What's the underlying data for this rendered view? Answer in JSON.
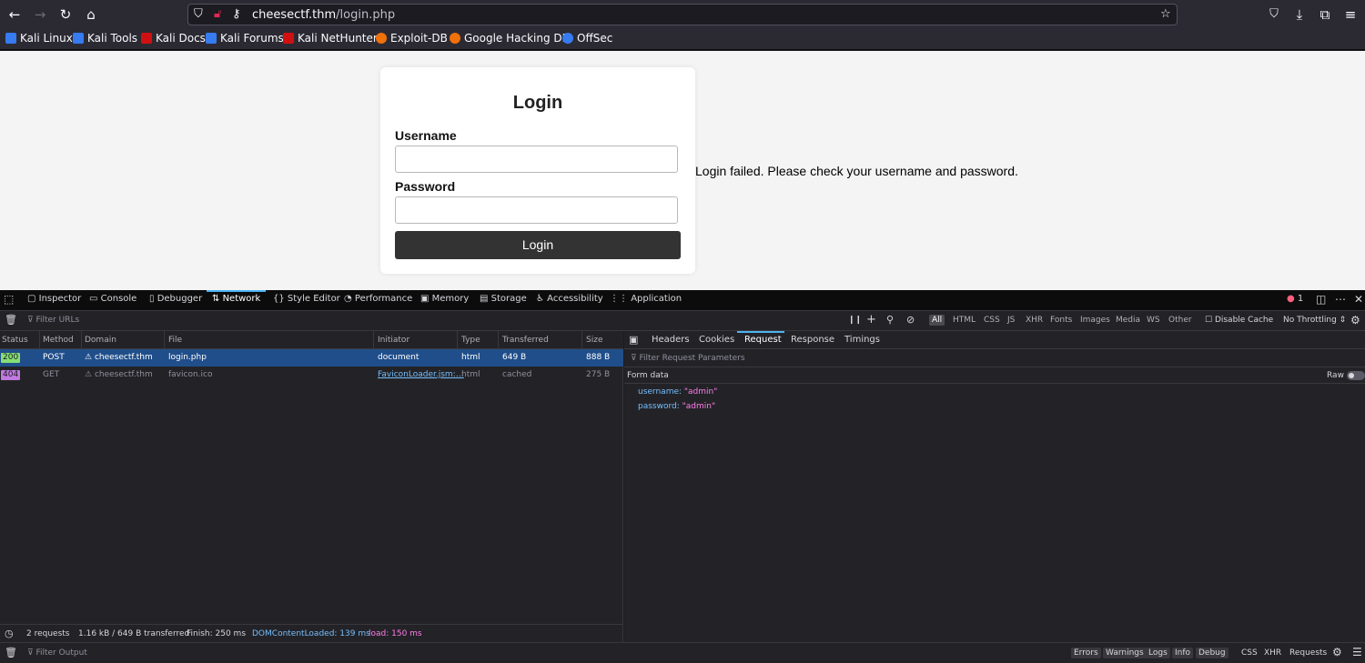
{
  "browser": {
    "url_host": "cheesectf.thm",
    "url_path": "/login.php",
    "bookmarks": [
      {
        "label": "Kali Linux",
        "color": "#367bf0"
      },
      {
        "label": "Kali Tools",
        "color": "#367bf0"
      },
      {
        "label": "Kali Docs",
        "color": "#d01010"
      },
      {
        "label": "Kali Forums",
        "color": "#367bf0"
      },
      {
        "label": "Kali NetHunter",
        "color": "#d01010"
      },
      {
        "label": "Exploit-DB",
        "color": "#f0700a"
      },
      {
        "label": "Google Hacking DB",
        "color": "#f0700a"
      },
      {
        "label": "OffSec",
        "color": "#367bf0"
      }
    ]
  },
  "page": {
    "title": "Login",
    "username_label": "Username",
    "password_label": "Password",
    "login_button": "Login",
    "error_message": "Login failed. Please check your username and password."
  },
  "devtools": {
    "tabs": [
      "Inspector",
      "Console",
      "Debugger",
      "Network",
      "Style Editor",
      "Performance",
      "Memory",
      "Storage",
      "Accessibility",
      "Application"
    ],
    "active_tab": "Network",
    "error_count": "1",
    "filter_placeholder": "Filter URLs",
    "type_filters": [
      "All",
      "HTML",
      "CSS",
      "JS",
      "XHR",
      "Fonts",
      "Images",
      "Media",
      "WS",
      "Other"
    ],
    "disable_cache": "Disable Cache",
    "throttling": "No Throttling",
    "columns": [
      "Status",
      "Method",
      "Domain",
      "File",
      "Initiator",
      "Type",
      "Transferred",
      "Size"
    ],
    "requests": [
      {
        "status": "200",
        "method": "POST",
        "domain": "cheesectf.thm",
        "file": "login.php",
        "initiator": "document",
        "type": "html",
        "transferred": "649 B",
        "size": "888 B",
        "selected": true
      },
      {
        "status": "404",
        "method": "GET",
        "domain": "cheesectf.thm",
        "file": "favicon.ico",
        "initiator": "FaviconLoader.jsm:…",
        "type": "html",
        "transferred": "cached",
        "size": "275 B",
        "selected": false
      }
    ],
    "detail_tabs": [
      "Headers",
      "Cookies",
      "Request",
      "Response",
      "Timings"
    ],
    "active_detail_tab": "Request",
    "params_placeholder": "Filter Request Parameters",
    "form_data_label": "Form data",
    "raw_label": "Raw",
    "form_data": [
      {
        "key": "username:",
        "value": "\"admin\""
      },
      {
        "key": "password:",
        "value": "\"admin\""
      }
    ],
    "summary": {
      "requests": "2 requests",
      "transferred": "1.16 kB / 649 B transferred",
      "finish": "Finish: 250 ms",
      "dom_loaded": "DOMContentLoaded: 139 ms",
      "load": "load: 150 ms"
    },
    "console": {
      "filter_placeholder": "Filter Output",
      "levels": [
        "Errors",
        "Warnings",
        "Logs",
        "Info",
        "Debug"
      ],
      "extra": [
        "CSS",
        "XHR",
        "Requests"
      ]
    }
  }
}
